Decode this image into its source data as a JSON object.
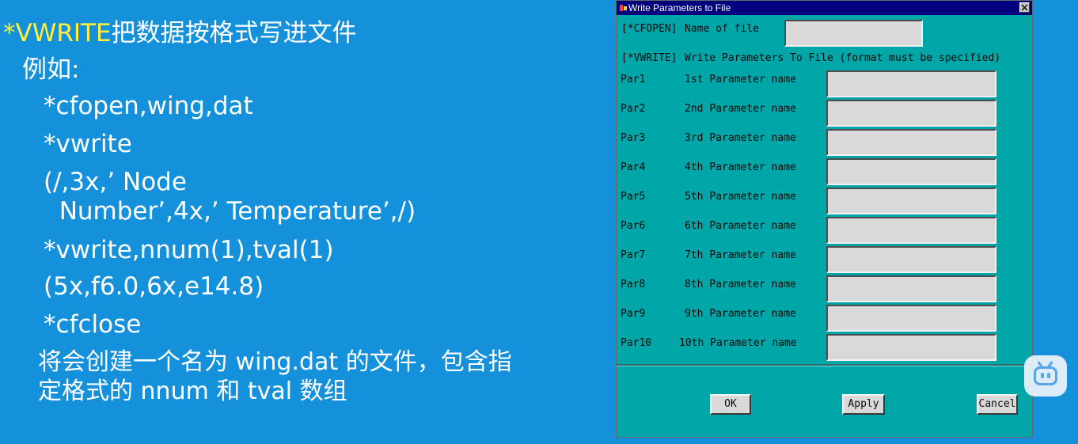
{
  "slide": {
    "title_kw": "*VWRITE",
    "title_cn": "把数据按格式写进文件",
    "example_label": "例如:",
    "code": [
      "*cfopen,wing,dat",
      "*vwrite",
      "(/,3x,’ Node",
      "  Number’,4x,’ Temperature’,/)",
      "*vwrite,nnum(1),tval(1)",
      "(5x,f6.0,6x,e14.8)",
      "*cfclose"
    ],
    "description": [
      "将会创建一个名为 wing.dat 的文件，包含指",
      "定格式的 nnum 和 tval 数组"
    ]
  },
  "dialog": {
    "title": "Write Parameters to File",
    "cfopen_tag": "[*CFOPEN]",
    "cfopen_label": "Name of file",
    "file_value": "",
    "vwrite_tag": "[*VWRITE]",
    "vwrite_desc": "Write Parameters To File (format must be specified)",
    "params": [
      {
        "tag": "Par1",
        "label": "1st Parameter name",
        "value": ""
      },
      {
        "tag": "Par2",
        "label": "2nd Parameter name",
        "value": ""
      },
      {
        "tag": "Par3",
        "label": "3rd Parameter name",
        "value": ""
      },
      {
        "tag": "Par4",
        "label": "4th Parameter name",
        "value": ""
      },
      {
        "tag": "Par5",
        "label": "5th Parameter name",
        "value": ""
      },
      {
        "tag": "Par6",
        "label": "6th Parameter name",
        "value": ""
      },
      {
        "tag": "Par7",
        "label": "7th Parameter name",
        "value": ""
      },
      {
        "tag": "Par8",
        "label": "8th Parameter name",
        "value": ""
      },
      {
        "tag": "Par9",
        "label": "9th Parameter name",
        "value": ""
      },
      {
        "tag": "Par10",
        "label": "10th Parameter name",
        "value": ""
      }
    ],
    "buttons": {
      "ok": "OK",
      "apply": "Apply",
      "cancel": "Cancel"
    }
  },
  "icons": {
    "close": "close-icon",
    "app": "app-icon",
    "badge": "tv-badge-icon"
  },
  "colors": {
    "slide_bg": "#1591dc",
    "title_kw": "#ffef3a",
    "dialog_bg": "#00a6a8",
    "titlebar": "#00007f"
  }
}
